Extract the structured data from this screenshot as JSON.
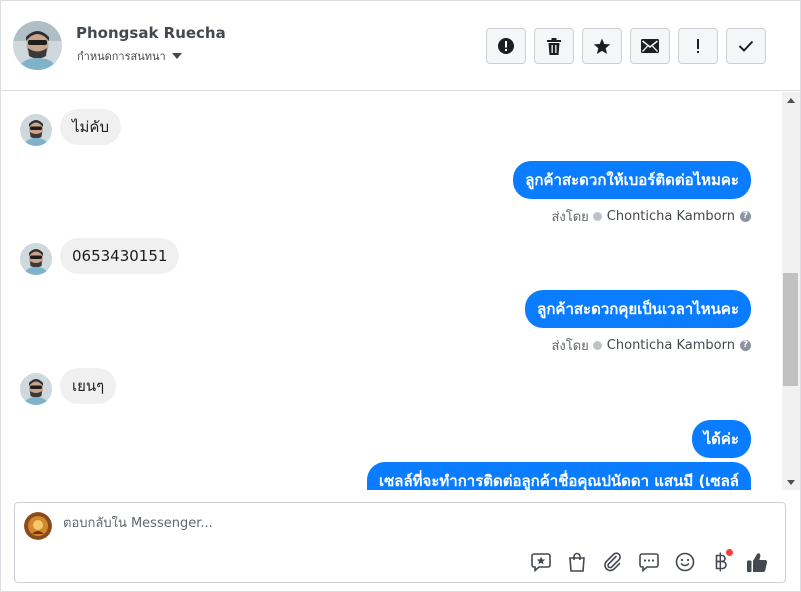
{
  "header": {
    "contact_name": "Phongsak Ruecha",
    "conversation_setting": "กำหนดการสนทนา",
    "actions": [
      {
        "name": "report-spam-button",
        "icon": "alert-circle-icon"
      },
      {
        "name": "delete-button",
        "icon": "trash-icon"
      },
      {
        "name": "star-button",
        "icon": "star-icon"
      },
      {
        "name": "mark-unread-button",
        "icon": "envelope-icon"
      },
      {
        "name": "follow-up-button",
        "icon": "exclamation-icon"
      },
      {
        "name": "mark-done-button",
        "icon": "check-icon"
      }
    ]
  },
  "messages": [
    {
      "dir": "in",
      "text": "ไม่คับ"
    },
    {
      "dir": "out",
      "text": "ลูกค้าสะดวกให้เบอร์ติดต่อไหมคะ",
      "sent_by_label": "ส่งโดย",
      "agent": "Chonticha Kamborn"
    },
    {
      "dir": "in",
      "text": "0653430151"
    },
    {
      "dir": "out",
      "text": "ลูกค้าสะดวกคุยเป็นเวลาไหนคะ",
      "sent_by_label": "ส่งโดย",
      "agent": "Chonticha Kamborn"
    },
    {
      "dir": "in",
      "text": "เยนๆ"
    },
    {
      "dir": "out",
      "text": "ได้ค่ะ"
    },
    {
      "dir": "out",
      "text": "เซลล์ที่จะทำการติดต่อลูกค้าชื่อคุณปนัดดา แสนมี (เซลล์"
    }
  ],
  "composer": {
    "placeholder": "ตอบกลับใน Messenger...",
    "tools": [
      "saved-reply-icon",
      "shop-bag-icon",
      "attachment-icon",
      "chat-bubble-icon",
      "emoji-icon",
      "baht-icon",
      "thumbs-up-icon"
    ]
  },
  "colors": {
    "outgoing_bubble": "#0a7cff",
    "incoming_bubble": "#f1f0f0",
    "notification_dot": "#fa3e3e"
  }
}
